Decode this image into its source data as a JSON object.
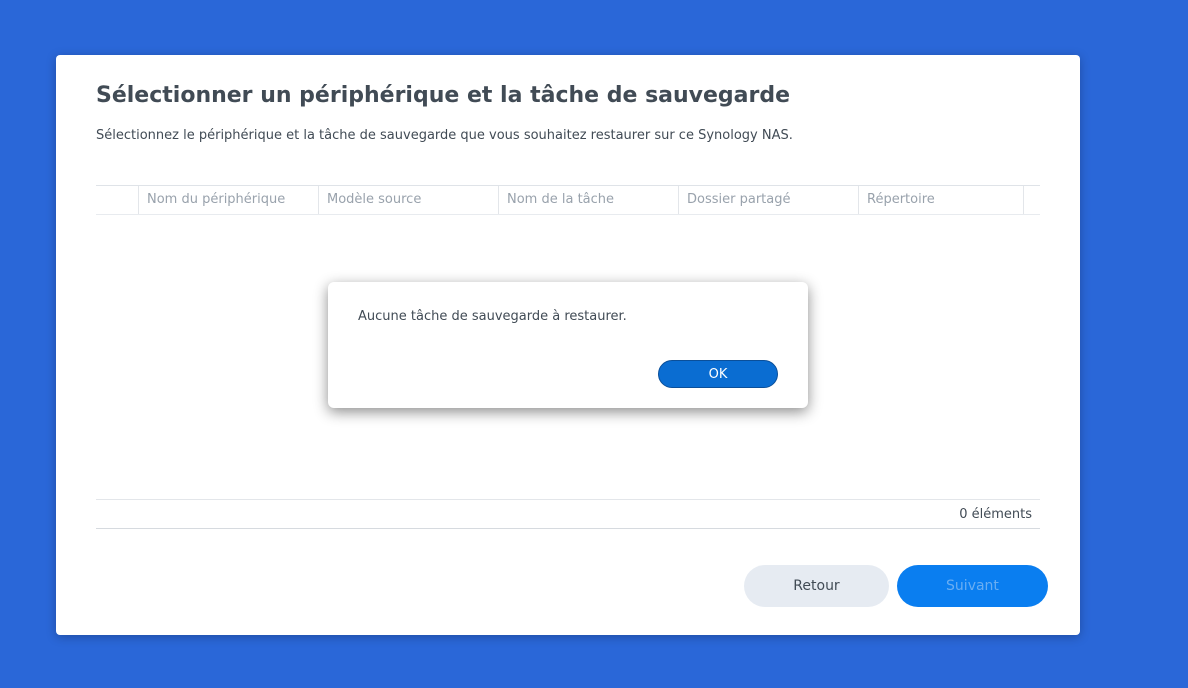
{
  "wizard": {
    "title": "Sélectionner un périphérique et la tâche de sauvegarde",
    "subtitle": "Sélectionnez le périphérique et la tâche de sauvegarde que vous souhaitez restaurer sur ce Synology NAS."
  },
  "table": {
    "columns": [
      "Nom du périphérique",
      "Modèle source",
      "Nom de la tâche",
      "Dossier partagé",
      "Répertoire"
    ],
    "rows": [],
    "item_count": "0 éléments"
  },
  "buttons": {
    "back_label": "Retour",
    "next_label": "Suivant"
  },
  "dialog": {
    "message": "Aucune tâche de sauvegarde à restaurer.",
    "ok_label": "OK"
  },
  "colors": {
    "background": "#2a67d8",
    "primary": "#0a7ef0",
    "text": "#414b55"
  }
}
